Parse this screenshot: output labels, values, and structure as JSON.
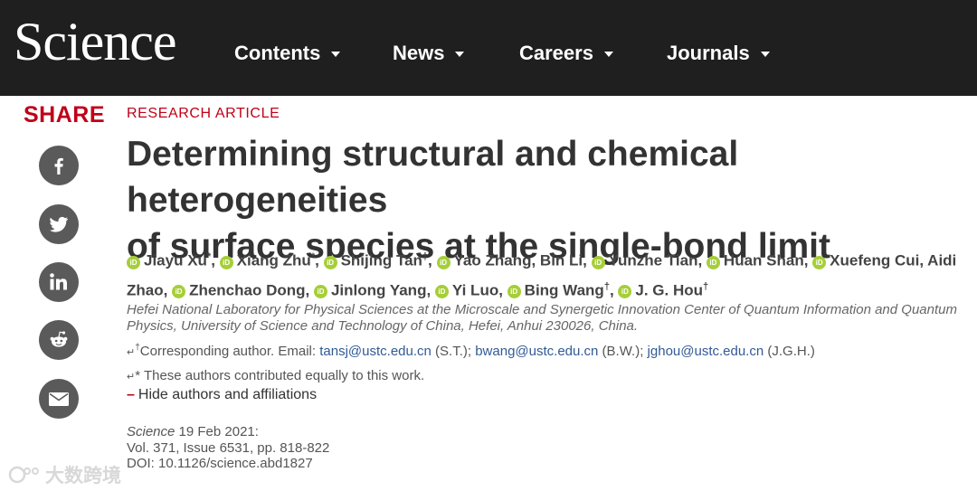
{
  "header": {
    "logo": "Science",
    "nav": [
      {
        "label": "Contents"
      },
      {
        "label": "News"
      },
      {
        "label": "Careers"
      },
      {
        "label": "Journals"
      }
    ]
  },
  "share": {
    "label": "SHARE",
    "icons": [
      "facebook-icon",
      "twitter-icon",
      "linkedin-icon",
      "reddit-icon",
      "email-icon"
    ]
  },
  "article": {
    "kicker": "RESEARCH ARTICLE",
    "title_line1": "Determining structural and chemical heterogeneities",
    "title_line2": "of surface species at the single-bond limit",
    "authors": [
      {
        "name": "Jiayu Xu",
        "mark": "*",
        "sep": ", "
      },
      {
        "name": "Xiang Zhu",
        "mark": "*",
        "sep": ", "
      },
      {
        "name": "Shijing Tan",
        "mark": "†",
        "sep": ", "
      },
      {
        "name": "Yao Zhang",
        "mark": "",
        "sep": ", "
      },
      {
        "name": "Bin Li",
        "mark": "",
        "sep": ", ",
        "no_orcid": true
      },
      {
        "name": "Yunzhe Tian",
        "mark": "",
        "sep": ", "
      },
      {
        "name": "Huan Shan",
        "mark": "",
        "sep": ", "
      },
      {
        "name": "Xuefeng Cui",
        "mark": "",
        "sep": ", "
      },
      {
        "name": "Aidi Zhao",
        "mark": "",
        "sep": ", ",
        "no_orcid": true
      },
      {
        "name": "Zhenchao Dong",
        "mark": "",
        "sep": ", "
      },
      {
        "name": "Jinlong Yang",
        "mark": "",
        "sep": ", "
      },
      {
        "name": "Yi Luo",
        "mark": "",
        "sep": ", "
      },
      {
        "name": "Bing Wang",
        "mark": "†",
        "sep": ", "
      },
      {
        "name": "J. G. Hou",
        "mark": "†",
        "sep": ""
      }
    ],
    "orcid_label": "iD",
    "affiliation": "Hefei National Laboratory for Physical Sciences at the Microscale and Synergetic Innovation Center of Quantum Information and Quantum Physics, University of Science and Technology of China, Hefei, Anhui 230026, China.",
    "corr_arrow": "↵",
    "corr_mark": "†",
    "corr_prefix": "Corresponding author. Email: ",
    "emails": [
      {
        "addr": "tansj@ustc.edu.cn",
        "who": " (S.T.); "
      },
      {
        "addr": "bwang@ustc.edu.cn",
        "who": " (B.W.); "
      },
      {
        "addr": "jghou@ustc.edu.cn",
        "who": " (J.G.H.)"
      }
    ],
    "equal_arrow": "↵",
    "equal_text": "* These authors contributed equally to this work.",
    "hide_dash": "–",
    "hide_label": "Hide authors and affiliations",
    "journal": "Science",
    "date": " 19 Feb 2021:",
    "volume": "Vol. 371, Issue 6531, pp. 818-822",
    "doi": "DOI: 10.1126/science.abd1827"
  },
  "watermark": "大数跨境",
  "colors": {
    "header_bg": "#1f1f1f",
    "accent_red": "#c00018",
    "share_icon_bg": "#5a5a5a",
    "orcid_green": "#a6ce39",
    "link_blue": "#315a96"
  }
}
